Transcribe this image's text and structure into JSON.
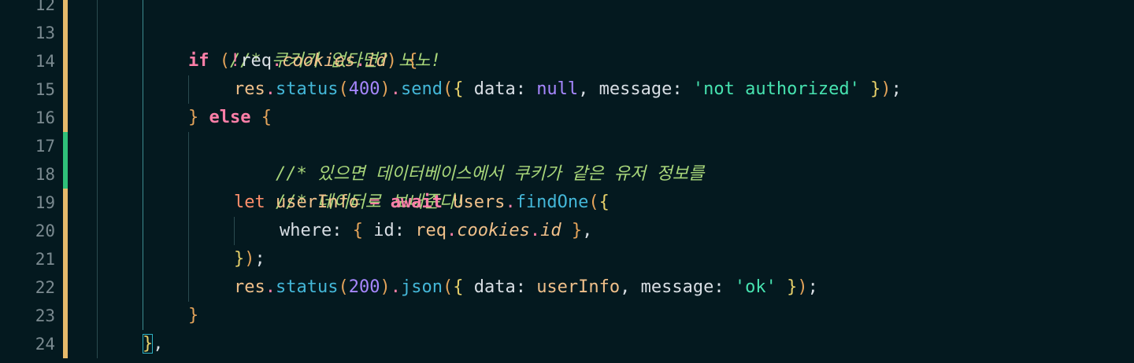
{
  "colors": {
    "background": "#04191f",
    "line_number": "#7b8a90",
    "modified_bar": "#e6b96a",
    "added_bar": "#2fc07a",
    "comment": "#a8d67a",
    "keyword": "#ff7fa8",
    "function": "#44b7d8",
    "string": "#47e3b0",
    "number": "#a787ff"
  },
  "line_numbers": [
    "12",
    "13",
    "14",
    "15",
    "16",
    "17",
    "18",
    "19",
    "20",
    "21",
    "22",
    "23",
    "24"
  ],
  "lines": {
    "l13": {
      "comment": "//* 쿠키가 없다면? 노노!"
    },
    "l14": {
      "if": "if",
      "paren_open": "(",
      "bang": "!",
      "req": "req",
      "dot1": ".",
      "cookies": "cookies",
      "dot2": ".",
      "id": "id",
      "paren_close": ")",
      "brace": "{"
    },
    "l15": {
      "res": "res",
      "dot1": ".",
      "status": "status",
      "p1": "(",
      "code": "400",
      "p2": ")",
      "dot2": ".",
      "send": "send",
      "p3": "(",
      "b1": "{",
      "data_key": " data: ",
      "null": "null",
      "comma1": ", ",
      "msg_key": "message: ",
      "msg": "'not authorized'",
      "sp": " ",
      "b2": "}",
      "p4": ")",
      "semi": ";"
    },
    "l16": {
      "brace_close": "}",
      "else": "else",
      "brace_open": "{"
    },
    "l17": {
      "comment": "//* 있으면 데이터베이스에서 쿠키가 같은 유저 정보를"
    },
    "l18": {
      "comment": "//* 데이터로 보내준다!"
    },
    "l19": {
      "let": "let",
      "name": "userInfo",
      "eq": "=",
      "await": "await",
      "users": "Users",
      "dot": ".",
      "findOne": "findOne",
      "p": "(",
      "b": "{"
    },
    "l20": {
      "where": "where: ",
      "b1": "{",
      "id_key": " id: ",
      "req": "req",
      "dot1": ".",
      "cookies": "cookies",
      "dot2": ".",
      "id": "id",
      "b2": " }",
      "comma": ","
    },
    "l21": {
      "b": "}",
      "p": ")",
      "semi": ";"
    },
    "l22": {
      "res": "res",
      "dot1": ".",
      "status": "status",
      "p1": "(",
      "code": "200",
      "p2": ")",
      "dot2": ".",
      "json": "json",
      "p3": "(",
      "b1": "{",
      "data_key": " data: ",
      "userInfo": "userInfo",
      "comma": ", ",
      "msg_key": "message: ",
      "msg": "'ok'",
      "sp": " ",
      "b2": "}",
      "p4": ")",
      "semi": ";"
    },
    "l23": {
      "brace": "}"
    },
    "l24": {
      "brace": "}",
      "comma": ","
    }
  }
}
